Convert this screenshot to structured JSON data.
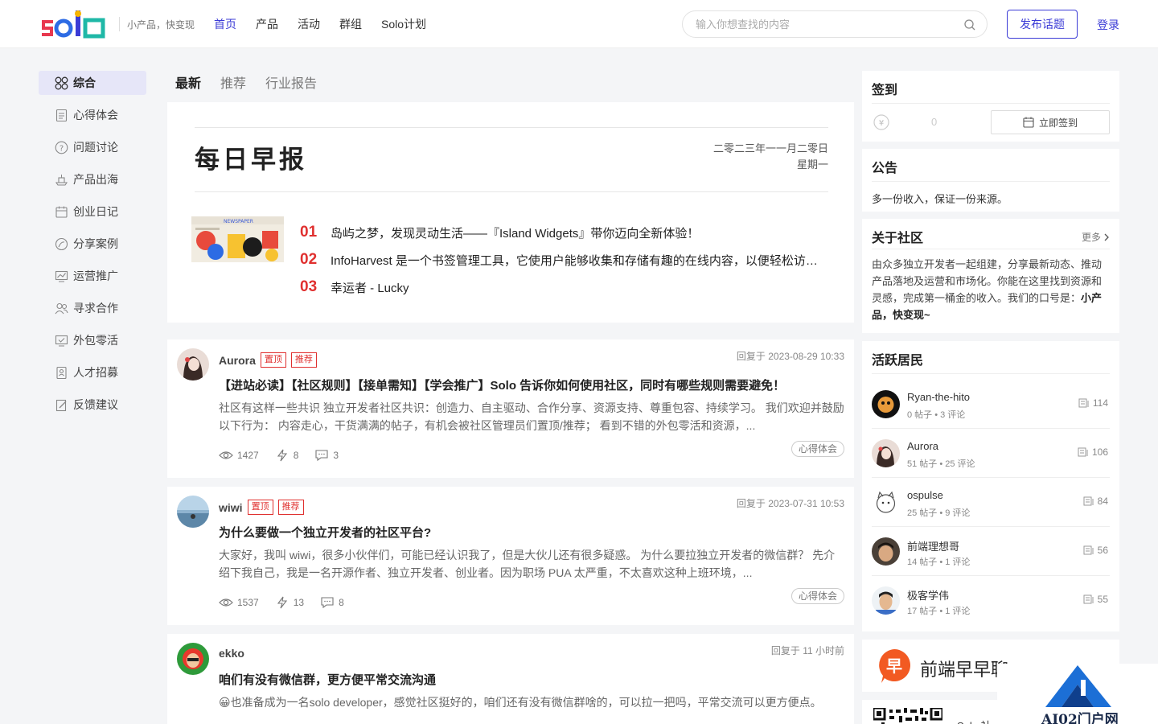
{
  "header": {
    "logo_text": "solo",
    "slogan": "小产品，快变现",
    "nav": [
      "首页",
      "产品",
      "活动",
      "群组",
      "Solo计划"
    ],
    "search_placeholder": "输入你想查找的内容",
    "publish_label": "发布话题",
    "login_label": "登录"
  },
  "sidebar": {
    "items": [
      {
        "label": "综合",
        "icon": "grid-icon"
      },
      {
        "label": "心得体会",
        "icon": "document-icon"
      },
      {
        "label": "问题讨论",
        "icon": "question-icon"
      },
      {
        "label": "产品出海",
        "icon": "ship-icon"
      },
      {
        "label": "创业日记",
        "icon": "calendar-icon"
      },
      {
        "label": "分享案例",
        "icon": "share-icon"
      },
      {
        "label": "运营推广",
        "icon": "chart-icon"
      },
      {
        "label": "寻求合作",
        "icon": "users-icon"
      },
      {
        "label": "外包零活",
        "icon": "monitor-icon"
      },
      {
        "label": "人才招募",
        "icon": "badge-icon"
      },
      {
        "label": "反馈建议",
        "icon": "edit-icon"
      }
    ]
  },
  "tabs": [
    "最新",
    "推荐",
    "行业报告"
  ],
  "daily": {
    "title": "每日早报",
    "date_line1": "二零二三年一一月二零日",
    "date_line2": "星期一",
    "items": [
      {
        "num": "01",
        "text": "岛屿之梦，发现灵动生活——『Island Widgets』带你迈向全新体验！"
      },
      {
        "num": "02",
        "text": "InfoHarvest 是一个书签管理工具，它使用户能够收集和存储有趣的在线内容，以便轻松访问和分享"
      },
      {
        "num": "03",
        "text": "幸运者 - Lucky"
      }
    ]
  },
  "posts": [
    {
      "author": "Aurora",
      "badges": [
        "置顶",
        "推荐"
      ],
      "time": "回复于 2023-08-29 10:33",
      "title": "【进站必读】【社区规则】【接单需知】【学会推广】Solo 告诉你如何使用社区，同时有哪些规则需要避免！",
      "summary": "社区有这样一些共识 独立开发者社区共识：创造力、自主驱动、合作分享、资源支持、尊重包容、持续学习。 我们欢迎并鼓励以下行为： 内容走心，干货满满的帖子，有机会被社区管理员们置顶/推荐； 看到不错的外包零活和资源，...",
      "views": "1427",
      "likes": "8",
      "comments": "3",
      "tag": "心得体会"
    },
    {
      "author": "wiwi",
      "badges": [
        "置顶",
        "推荐"
      ],
      "time": "回复于 2023-07-31 10:53",
      "title": "为什么要做一个独立开发者的社区平台?",
      "summary": "大家好，我叫 wiwi，很多小伙伴们，可能已经认识我了，但是大伙儿还有很多疑惑。 为什么要拉独立开发者的微信群？ 先介绍下我自己，我是一名开源作者、独立开发者、创业者。因为职场 PUA 太严重，不太喜欢这种上班环境，...",
      "views": "1537",
      "likes": "13",
      "comments": "8",
      "tag": "心得体会"
    },
    {
      "author": "ekko",
      "badges": [],
      "time": "回复于 11 小时前",
      "title": "咱们有没有微信群，更方便平常交流沟通",
      "summary": "😀也准备成为一名solo developer，感觉社区挺好的，咱们还有没有微信群啥的，可以拉一把吗，平常交流可以更方便点。",
      "views": "",
      "likes": "",
      "comments": "",
      "tag": ""
    }
  ],
  "checkin": {
    "title": "签到",
    "coins": "0",
    "button_label": "立即签到"
  },
  "notice": {
    "title": "公告",
    "text": "多一份收入，保证一份来源。"
  },
  "about": {
    "title": "关于社区",
    "more_label": "更多",
    "text": "由众多独立开发者一起组建，分享最新动态、推动产品落地及运营和市场化。你能在这里找到资源和灵感，完成第一桶金的收入。我们的口号是：",
    "slogan": "小产品，快变现~"
  },
  "members": {
    "title": "活跃居民",
    "list": [
      {
        "name": "Ryan-the-hito",
        "sub": "0 帖子 • 3 评论",
        "count": "114"
      },
      {
        "name": "Aurora",
        "sub": "51 帖子 • 25 评论",
        "count": "106"
      },
      {
        "name": "ospulse",
        "sub": "25 帖子 • 9 评论",
        "count": "84"
      },
      {
        "name": "前端理想哥",
        "sub": "14 帖子 • 1 评论",
        "count": "56"
      },
      {
        "name": "极客学伟",
        "sub": "17 帖子 • 1 评论",
        "count": "55"
      }
    ]
  },
  "ad": {
    "text": "前端早早聊"
  },
  "qr": {
    "text": "Solo 社"
  },
  "watermark": {
    "text": "AI02门户网"
  },
  "colors": {
    "accent": "#3b3bd6",
    "badge_red": "#e0302f",
    "background": "#f4f5f7"
  }
}
